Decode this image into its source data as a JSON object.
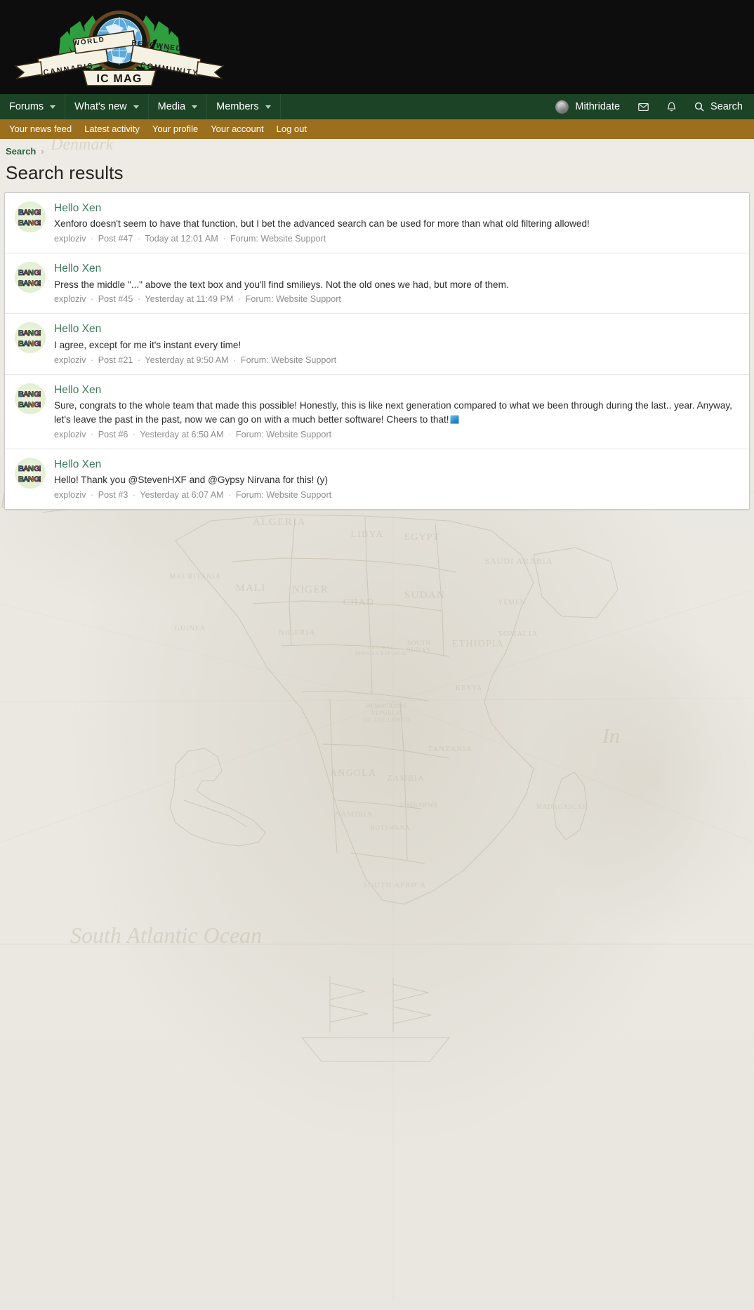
{
  "site": {
    "logo_text_top_left": "WORLD",
    "logo_text_top_right": "RENOWNED",
    "logo_text_bottom_left": "CANNABIS",
    "logo_text_bottom_right": "COMMUNITY",
    "logo_badge": "IC MAG",
    "logo_alt": "IC MAG - World Renowned Cannabis Community"
  },
  "colors": {
    "nav_green": "#1c4326",
    "subnav_gold": "#9c6f1e",
    "link_green": "#3e7a5a",
    "breadcrumb_green": "#2c6340",
    "header_black": "#0d0d0d",
    "page_bg": "#eceae4",
    "card_white": "#ffffff"
  },
  "mainnav": {
    "items": [
      {
        "label": "Forums",
        "has_caret": true
      },
      {
        "label": "What's new",
        "has_caret": true
      },
      {
        "label": "Media",
        "has_caret": true
      },
      {
        "label": "Members",
        "has_caret": true
      }
    ],
    "account": {
      "username": "Mithridate",
      "avatar_icon": "user-avatar"
    },
    "inbox_icon": "envelope-icon",
    "alerts_icon": "bell-icon",
    "search": {
      "label": "Search",
      "icon": "search-icon"
    }
  },
  "subnav": {
    "items": [
      {
        "label": "Your news feed"
      },
      {
        "label": "Latest activity"
      },
      {
        "label": "Your profile"
      },
      {
        "label": "Your account"
      },
      {
        "label": "Log out"
      }
    ]
  },
  "breadcrumb": {
    "items": [
      {
        "label": "Search"
      }
    ],
    "separator": "›"
  },
  "page": {
    "title": "Search results"
  },
  "results": [
    {
      "avatar_icon": "bang-bang-avatar",
      "title": "Hello Xen",
      "snippet": "Xenforo doesn't seem to have that function, but I bet the advanced search can be used for more than what old filtering allowed!",
      "has_emoji": false,
      "author": "exploziv",
      "post": "Post #47",
      "time": "Today at 12:01 AM",
      "forum": "Forum: Website Support"
    },
    {
      "avatar_icon": "bang-bang-avatar",
      "title": "Hello Xen",
      "snippet": "Press the middle \"...\" above the text box and you'll find smilieys. Not the old ones we had, but more of them.",
      "has_emoji": false,
      "author": "exploziv",
      "post": "Post #45",
      "time": "Yesterday at 11:49 PM",
      "forum": "Forum: Website Support"
    },
    {
      "avatar_icon": "bang-bang-avatar",
      "title": "Hello Xen",
      "snippet": "I agree, except for me it's instant every time!",
      "has_emoji": false,
      "author": "exploziv",
      "post": "Post #21",
      "time": "Yesterday at 9:50 AM",
      "forum": "Forum: Website Support"
    },
    {
      "avatar_icon": "bang-bang-avatar",
      "title": "Hello Xen",
      "snippet": "Sure, congrats to the whole team that made this possible! Honestly, this is like next generation compared to what we been through during the last.. year. Anyway, let's leave the past in the past, now we can go on with a much better software! Cheers to that!",
      "has_emoji": true,
      "emoji_name": "beer-cheers-emoji",
      "author": "exploziv",
      "post": "Post #6",
      "time": "Yesterday at 6:50 AM",
      "forum": "Forum: Website Support"
    },
    {
      "avatar_icon": "bang-bang-avatar",
      "title": "Hello Xen",
      "snippet": "Hello! Thank you @StevenHXF and @Gypsy Nirvana for this! (y)",
      "has_emoji": false,
      "author": "exploziv",
      "post": "Post #3",
      "time": "Yesterday at 6:07 AM",
      "forum": "Forum: Website Support"
    }
  ],
  "background": {
    "map_labels": [
      "Denmark",
      "ALGERIA",
      "LIBYA",
      "EGYPT",
      "SAUDI ARABIA",
      "MAURITANIA",
      "MALI",
      "NIGER",
      "CHAD",
      "SUDAN",
      "GUINEA",
      "NIGERIA",
      "SOUTH SUDAN",
      "ETHIOPIA",
      "YEMEN",
      "SOMALIA",
      "CENTRAL AFRICAN REPUBLIC",
      "KENYA",
      "DEMOCRATIC REPUBLIC OF THE CONGO",
      "TANZANIA",
      "ANGOLA",
      "ZAMBIA",
      "ZIMBABWE",
      "MADAGASCAR",
      "NAMIBIA",
      "BOTSWANA",
      "SOUTH AFRICA",
      "Atlantic Ocean",
      "South Atlantic Ocean",
      "Indian Ocean"
    ]
  }
}
